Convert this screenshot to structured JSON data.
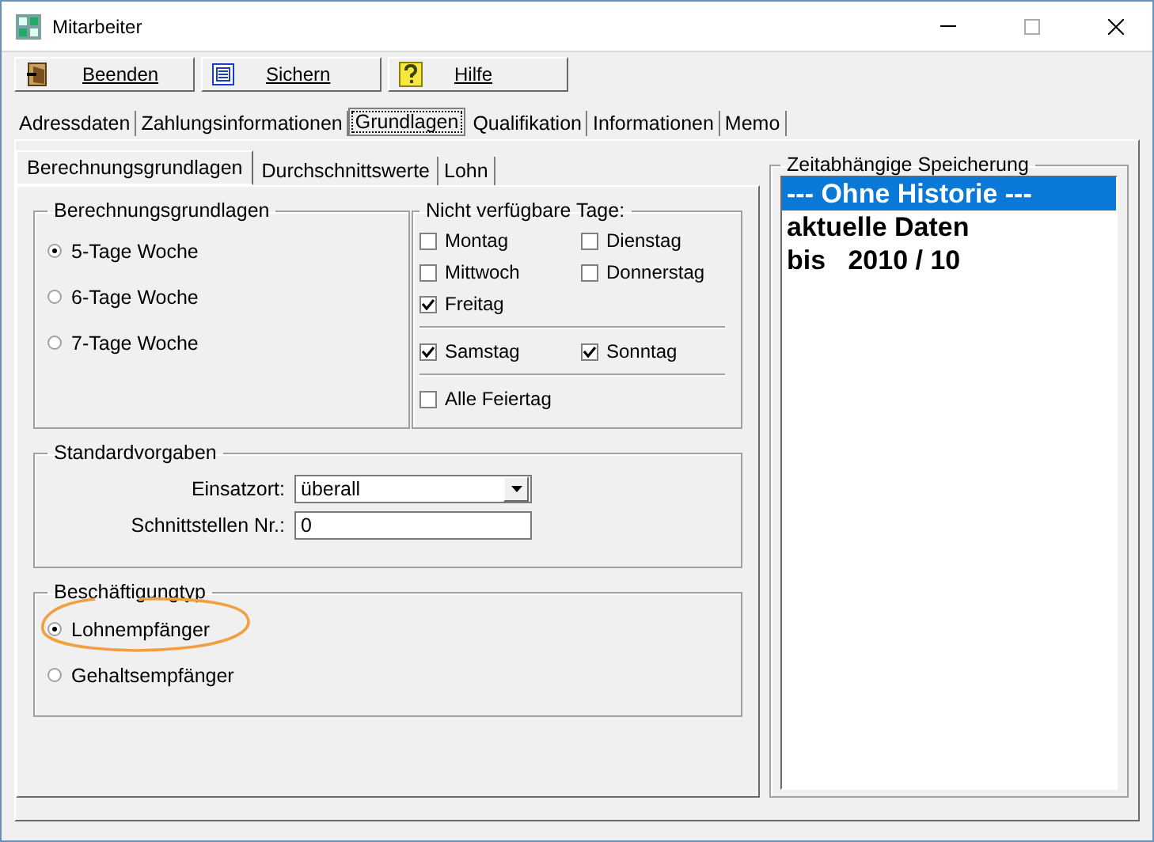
{
  "window": {
    "title": "Mitarbeiter"
  },
  "toolbar": [
    {
      "label": "Beenden",
      "kind": "exit"
    },
    {
      "label": "Sichern",
      "kind": "save"
    },
    {
      "label": "Hilfe",
      "kind": "help"
    }
  ],
  "tabs": [
    {
      "label": "Adressdaten",
      "selected": false
    },
    {
      "label": "Zahlungsinformationen",
      "selected": false
    },
    {
      "label": "Grundlagen",
      "selected": true
    },
    {
      "label": "Qualifikation",
      "selected": false
    },
    {
      "label": "Informationen",
      "selected": false
    },
    {
      "label": "Memo",
      "selected": false
    }
  ],
  "subtabs": [
    {
      "label": "Berechnungsgrundlagen",
      "selected": true
    },
    {
      "label": "Durchschnittswerte",
      "selected": false
    },
    {
      "label": "Lohn",
      "selected": false
    }
  ],
  "basis": {
    "title": "Berechnungsgrundlagen",
    "options": [
      {
        "label": "5-Tage Woche",
        "selected": true
      },
      {
        "label": "6-Tage Woche",
        "selected": false
      },
      {
        "label": "7-Tage Woche",
        "selected": false
      }
    ]
  },
  "unavailable_days": {
    "title": "Nicht verfügbare Tage:",
    "sections": [
      {
        "items": [
          {
            "label": "Montag",
            "checked": false
          },
          {
            "label": "Dienstag",
            "checked": false
          },
          {
            "label": "Mittwoch",
            "checked": false
          },
          {
            "label": "Donnerstag",
            "checked": false
          },
          {
            "label": "Freitag",
            "checked": true
          }
        ]
      },
      {
        "items": [
          {
            "label": "Samstag",
            "checked": true
          },
          {
            "label": "Sonntag",
            "checked": true
          }
        ]
      },
      {
        "items": [
          {
            "label": "Alle Feiertag",
            "checked": false
          }
        ]
      }
    ]
  },
  "defaults": {
    "title": "Standardvorgaben",
    "fields": [
      {
        "label": "Einsatzort:",
        "value": "überall",
        "kind": "dropdown"
      },
      {
        "label": "Schnittstellen Nr.:",
        "value": "0",
        "kind": "text"
      }
    ]
  },
  "employment_type": {
    "title": "Beschäftigungtyp",
    "options": [
      {
        "label": "Lohnempfänger",
        "selected": true,
        "highlighted": true
      },
      {
        "label": "Gehaltsempfänger",
        "selected": false,
        "highlighted": false
      }
    ]
  },
  "history": {
    "title": "Zeitabhängige Speicherung",
    "items": [
      {
        "label": "--- Ohne Historie ---",
        "selected": true
      },
      {
        "label": "aktuelle Daten",
        "selected": false
      },
      {
        "label": "bis   2010 / 10",
        "selected": false
      }
    ]
  }
}
